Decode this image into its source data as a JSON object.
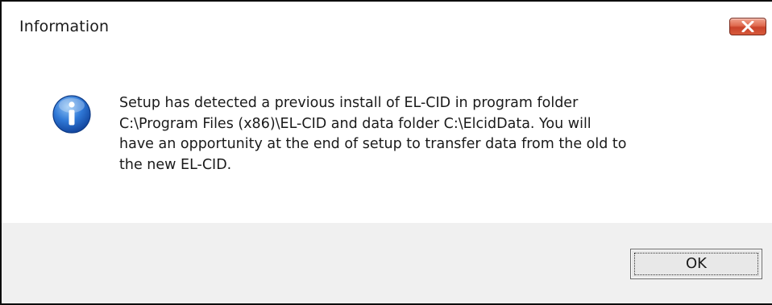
{
  "window": {
    "title": "Information",
    "close_icon": "close-icon"
  },
  "message": {
    "icon": "info-icon",
    "text": "Setup has detected a previous install of EL-CID in program folder\nC:\\Program Files (x86)\\EL-CID and data folder C:\\ElcidData.  You will\nhave an opportunity at the end of setup to transfer data from the old to\nthe new EL-CID."
  },
  "buttons": {
    "ok_label": "OK"
  },
  "colors": {
    "close_button": "#d75a3c",
    "info_icon": "#1e63c4",
    "footer_bg": "#f0f0f0"
  }
}
